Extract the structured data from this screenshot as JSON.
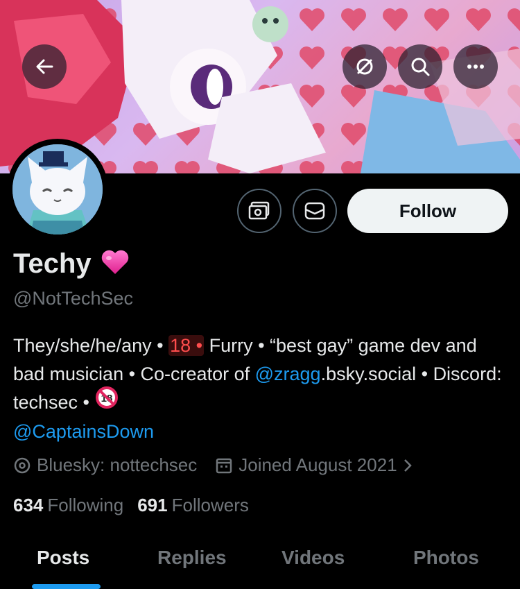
{
  "header": {
    "back_icon": "arrow-left-icon",
    "sync_icon": "no-sync-icon",
    "search_icon": "search-icon",
    "more_icon": "more-horizontal-icon"
  },
  "actions": {
    "subscribe_icon": "grok-image-icon",
    "message_icon": "envelope-icon",
    "follow_label": "Follow"
  },
  "profile": {
    "name": "Techy",
    "name_emoji": "heart-emoji",
    "handle": "@NotTechSec",
    "bio": {
      "part1": "They/she/he/any • ",
      "age": "18 •",
      "part2": " Furry • “best gay” game dev and bad musician • Co-creator of ",
      "mention1": "@zragg",
      "part3": ".bsky.social • Discord: techsec • ",
      "no18_icon": "no-under-18-icon",
      "mention2": "@CaptainsDown"
    },
    "location": "Bluesky: nottechsec",
    "joined": "Joined August 2021",
    "following_count": "634",
    "following_label": "Following",
    "followers_count": "691",
    "followers_label": "Followers"
  },
  "tabs": [
    {
      "label": "Posts",
      "active": true
    },
    {
      "label": "Replies",
      "active": false
    },
    {
      "label": "Videos",
      "active": false
    },
    {
      "label": "Photos",
      "active": false
    }
  ],
  "colors": {
    "accent": "#1d9bf0",
    "background": "#000000",
    "secondary_text": "#71767b"
  }
}
